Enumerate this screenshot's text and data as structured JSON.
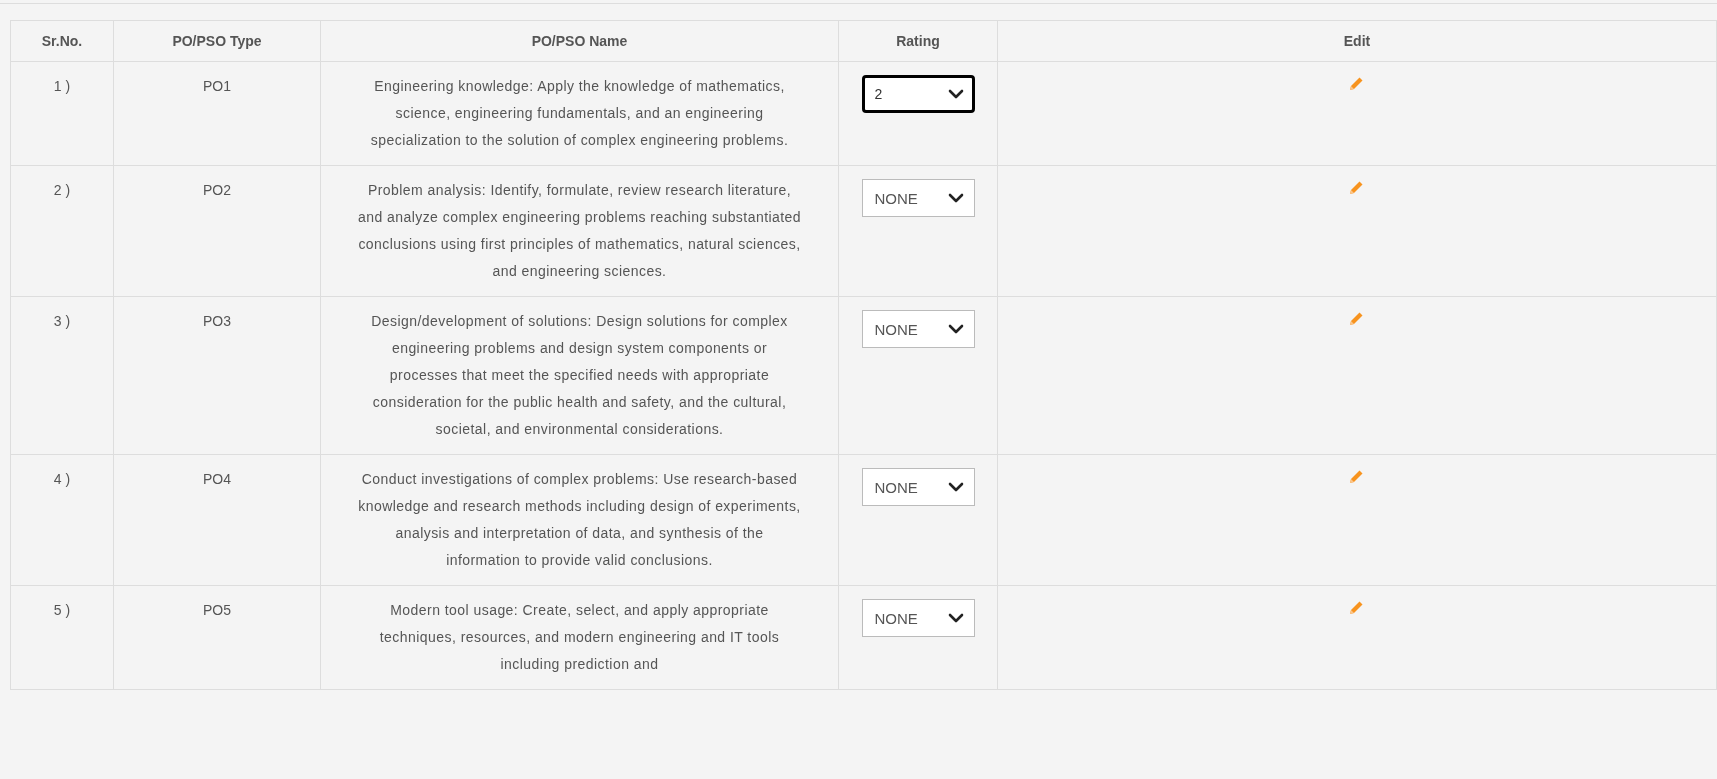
{
  "table": {
    "columns": [
      "Sr.No.",
      "PO/PSO Type",
      "PO/PSO Name",
      "Rating",
      "Edit"
    ],
    "rows": [
      {
        "sr_no": "1 )",
        "type": "PO1",
        "name": "Engineering knowledge: Apply the knowledge of mathematics, science, engineering fundamentals, and an engineering specialization to the solution of complex engineering problems.",
        "rating": "2",
        "focused": true
      },
      {
        "sr_no": "2 )",
        "type": "PO2",
        "name": "Problem analysis: Identify, formulate, review research literature, and analyze complex engineering problems reaching substantiated conclusions using first principles of mathematics, natural sciences, and engineering sciences.",
        "rating": "NONE",
        "focused": false
      },
      {
        "sr_no": "3 )",
        "type": "PO3",
        "name": "Design/development of solutions: Design solutions for complex engineering problems and design system components or processes that meet the specified needs with appropriate consideration for the public health and safety, and the cultural, societal, and environmental considerations.",
        "rating": "NONE",
        "focused": false
      },
      {
        "sr_no": "4 )",
        "type": "PO4",
        "name": "Conduct investigations of complex problems: Use research-based knowledge and research methods including design of experiments, analysis and interpretation of data, and synthesis of the information to provide valid conclusions.",
        "rating": "NONE",
        "focused": false
      },
      {
        "sr_no": "5 )",
        "type": "PO5",
        "name": "Modern tool usage: Create, select, and apply appropriate techniques, resources, and modern engineering and IT tools including prediction and",
        "rating": "NONE",
        "focused": false
      }
    ]
  }
}
